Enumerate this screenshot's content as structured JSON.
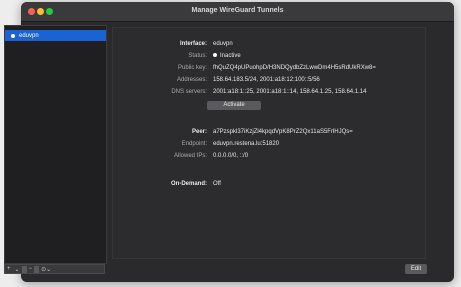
{
  "window": {
    "title": "Manage WireGuard Tunnels"
  },
  "sidebar": {
    "tunnels": [
      {
        "name": "eduvpn"
      }
    ],
    "bottom_bar": {
      "add": "+",
      "add_menu": "⌄",
      "remove": "−",
      "actions": "⊙⌄"
    }
  },
  "detail": {
    "interface": {
      "label": "Interface:",
      "value": "eduvpn",
      "status_label": "Status:",
      "status_value": "Inactive",
      "public_key_label": "Public key:",
      "public_key_value": "fhQuZQ4pUPuohpD/H3NDQydbZzLwwDm4H5sRdUkRXw8=",
      "addresses_label": "Addresses:",
      "addresses_value": "158.64.183.5/24, 2001:a18:12:100::5/56",
      "dns_label": "DNS servers:",
      "dns_value": "2001:a18:1::25, 2001:a18:1::14, 158.64.1.25, 158.64.1.14",
      "activate_button": "Activate"
    },
    "peer": {
      "label": "Peer:",
      "value": "a7Pzspkl37iKzjZl4kpqdVpK8PrZ2Qx11aS5FrlHJQs=",
      "endpoint_label": "Endpoint:",
      "endpoint_value": "eduvpn.restena.lu:51820",
      "allowed_ips_label": "Allowed IPs:",
      "allowed_ips_value": "0.0.0.0/0, ::/0"
    },
    "on_demand": {
      "label": "On-Demand:",
      "value": "Off"
    }
  },
  "footer": {
    "edit_button": "Edit"
  }
}
